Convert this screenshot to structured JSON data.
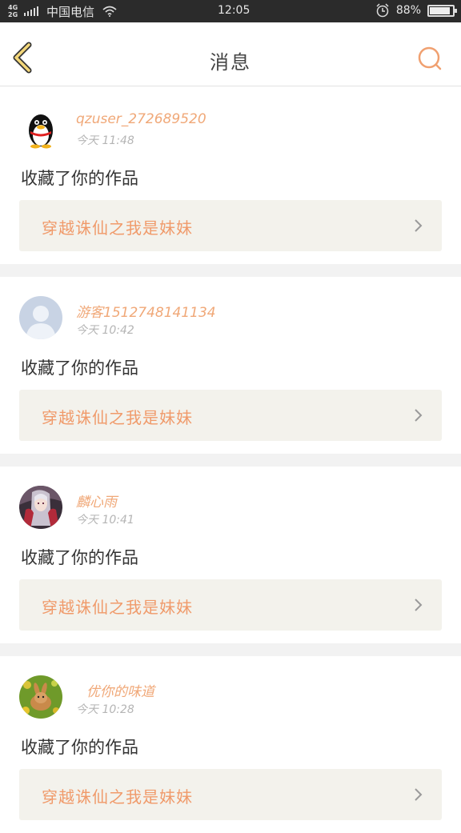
{
  "status_bar": {
    "network_top": "4G",
    "network_bottom": "2G",
    "carrier": "中国电信",
    "time": "12:05",
    "battery_pct": "88%",
    "battery_level": 0.88
  },
  "header": {
    "title": "消息",
    "icons": {
      "back": "back-chevron-icon",
      "search": "search-icon"
    },
    "accent_color": "#f0a070"
  },
  "messages": [
    {
      "username": "qzuser_272689520",
      "time": "今天 11:48",
      "action": "收藏了你的作品",
      "work_title": "穿越诛仙之我是妹妹",
      "avatar": "penguin-avatar"
    },
    {
      "username": "游客15127481411​34",
      "time": "今天 10:42",
      "action": "收藏了你的作品",
      "work_title": "穿越诛仙之我是妹妹",
      "avatar": "default-person-avatar"
    },
    {
      "username": "麟心雨",
      "time": "今天 10:41",
      "action": "收藏了你的作品",
      "work_title": "穿越诛仙之我是妹妹",
      "avatar": "anime-girl-avatar"
    },
    {
      "username": "优你的味道",
      "time": "今天 10:28",
      "action": "收藏了你的作品",
      "work_title": "穿越诛仙之我是妹妹",
      "avatar": "rabbit-avatar"
    }
  ]
}
